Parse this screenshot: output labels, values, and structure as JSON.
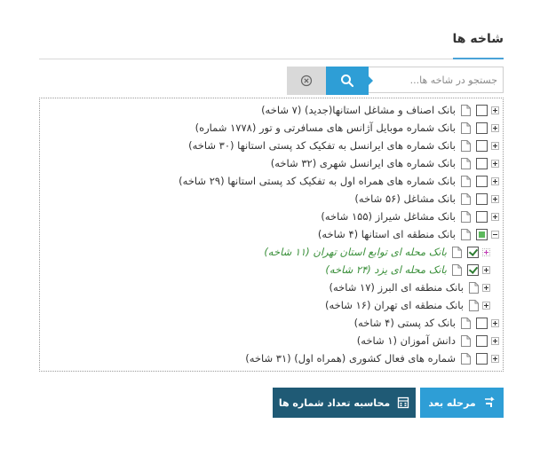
{
  "header": {
    "title": "شاخه ها"
  },
  "search": {
    "placeholder": "جستجو در شاخه ها...",
    "value": ""
  },
  "tree": [
    {
      "label": "بانک اصناف و مشاغل استانها(جدید) (۷ شاخه)",
      "toggle": "plus",
      "checkbox": "unchecked"
    },
    {
      "label": "بانک شماره موبایل آژانس های مسافرتی و تور (۱۷۷۸ شماره)",
      "toggle": "plus",
      "checkbox": "unchecked"
    },
    {
      "label": "بانک شماره های ایرانسل به تفکیک کد پستی استانها (۳۰ شاخه)",
      "toggle": "plus",
      "checkbox": "unchecked"
    },
    {
      "label": "بانک شماره های ایرانسل شهری (۳۲ شاخه)",
      "toggle": "plus",
      "checkbox": "unchecked"
    },
    {
      "label": "بانک شماره های همراه اول به تفکیک کد پستی استانها (۲۹ شاخه)",
      "toggle": "plus",
      "checkbox": "unchecked"
    },
    {
      "label": "بانک مشاغل (۵۶ شاخه)",
      "toggle": "plus",
      "checkbox": "unchecked"
    },
    {
      "label": "بانک مشاغل شیراز (۱۵۵ شاخه)",
      "toggle": "plus",
      "checkbox": "unchecked"
    },
    {
      "label": "بانک منطقه ای استانها (۴ شاخه)",
      "toggle": "minus",
      "checkbox": "partial"
    },
    {
      "label": "بانک محله ای توابع استان تهران (۱۱ شاخه)",
      "toggle": "dashed",
      "checkbox": "checked",
      "selected": true,
      "level": 1
    },
    {
      "label": "بانک محله ای یزد (۲۴ شاخه)",
      "toggle": "plus",
      "checkbox": "checked",
      "selected": true,
      "level": 1
    },
    {
      "label": "بانک منطقه ای البرز (۱۷ شاخه)",
      "toggle": "plus",
      "checkbox": "none",
      "level": 1
    },
    {
      "label": "بانک منطقه ای تهران (۱۶ شاخه)",
      "toggle": "plus",
      "checkbox": "none",
      "level": 1
    },
    {
      "label": "بانک کد پستی (۴ شاخه)",
      "toggle": "plus",
      "checkbox": "unchecked"
    },
    {
      "label": "دانش آموزان (۱ شاخه)",
      "toggle": "plus",
      "checkbox": "unchecked"
    },
    {
      "label": "شماره های فعال کشوری (همراه اول) (۳۱ شاخه)",
      "toggle": "plus",
      "checkbox": "unchecked"
    }
  ],
  "actions": {
    "next_label": "مرحله بعد",
    "calc_label": "محاسبه تعداد شماره ها"
  },
  "colors": {
    "accent": "#2e9ed6",
    "dark_button": "#1f5a75",
    "selected_text": "#3a8f3a",
    "partial_fill": "#5cb85c"
  }
}
